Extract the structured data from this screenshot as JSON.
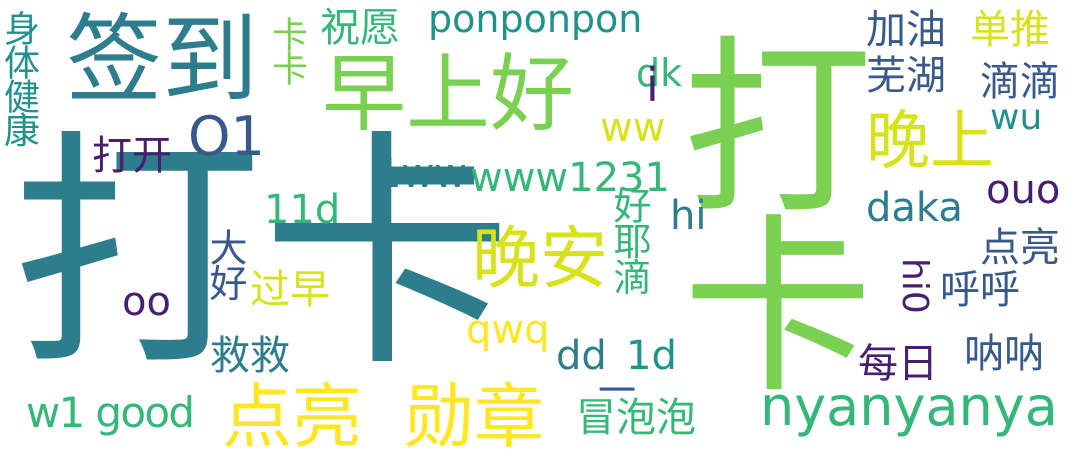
{
  "palette": {
    "background": "#ffffff",
    "teal": "#2e7d8c",
    "blue": "#38598c",
    "indigo": "#3b528b",
    "deep_purple": "#481f70",
    "sea_green": "#21918c",
    "green": "#35b779",
    "lime": "#7ad151",
    "yellow": "#d8e219",
    "bright_yellow": "#fde725"
  },
  "words": {
    "punch_in": "打卡",
    "punch_in_alt": "打卡",
    "sign_in": "签到",
    "good_morning": "早上好",
    "evening": "晚上",
    "good_night": "晚安",
    "light_up_medal_a": "点亮",
    "light_up_medal_b": "勋章",
    "nyanyanya": "nyanyanya",
    "ponponpon": "ponponpon",
    "fighting": "加油",
    "single_push": "单推",
    "wuhu": "芜湖",
    "didi": "滴滴",
    "wish": "祝愿",
    "kaka": "卡卡",
    "dk": "dk",
    "o1": "O1",
    "open": "打开",
    "ww": "ww",
    "wu": "wu",
    "health": "身体健康",
    "one_ww": "1ww",
    "www1231": "www1231",
    "ouo": "ouo",
    "eleven_d": "11d",
    "daka": "daka",
    "hi": "hi",
    "hello_all": "大好",
    "haoyedi": "好耶滴",
    "light_up": "点亮",
    "hi0": "hi0",
    "huhu": "呼呼",
    "oo": "oo",
    "passed_early": "过早",
    "qwq": "qwq",
    "save": "救救",
    "dd": "dd",
    "one_d": "1d",
    "daily": "每日",
    "nana": "呐呐",
    "w1_good": "w1 good",
    "bubbles": "冒泡泡",
    "i_mark": "i",
    "dash_mark": "一"
  }
}
